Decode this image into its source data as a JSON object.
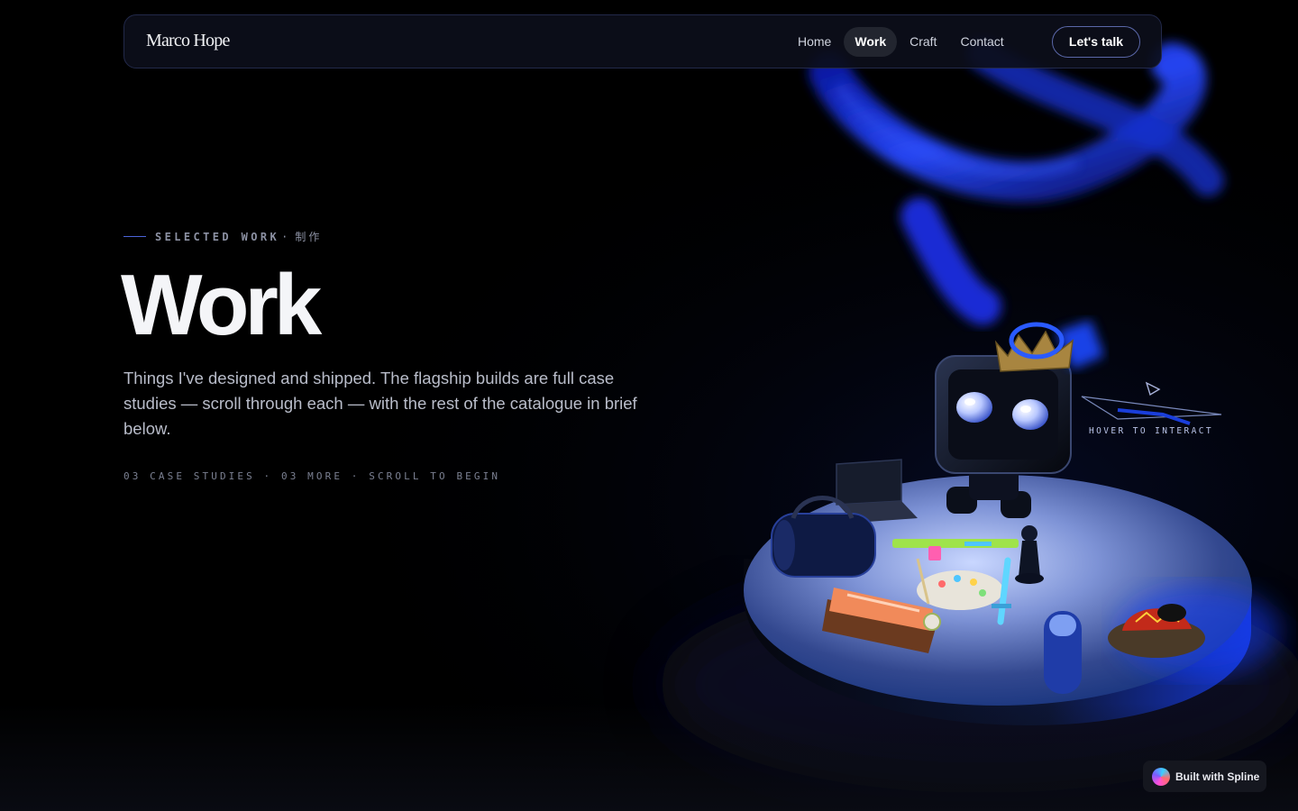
{
  "nav": {
    "brand": "Marco Hope",
    "links": [
      {
        "label": "Home",
        "active": false
      },
      {
        "label": "Work",
        "active": true
      },
      {
        "label": "Craft",
        "active": false
      },
      {
        "label": "Contact",
        "active": false
      }
    ],
    "cta": "Let's talk"
  },
  "hero": {
    "eyebrow": "SELECTED WORK",
    "eyebrow_separator": "·",
    "eyebrow_cjk": "制作",
    "title": "Work",
    "lede": "Things I've designed and shipped. The flagship builds are full case studies — scroll through each — with the rest of the catalogue in brief below.",
    "meta": "03 CASE STUDIES · 03 MORE · SCROLL TO BEGIN"
  },
  "scene": {
    "hover_hint": "HOVER TO INTERACT",
    "accent_color": "#1f3dff",
    "icons": [
      "torus-knot",
      "robot",
      "crown",
      "laptop",
      "duffel-bag",
      "toy-gun",
      "chess-pawn",
      "paint-palette",
      "sword",
      "sushi",
      "skateboard",
      "hat",
      "paper-plane"
    ]
  },
  "badge": {
    "label": "Built with Spline"
  }
}
